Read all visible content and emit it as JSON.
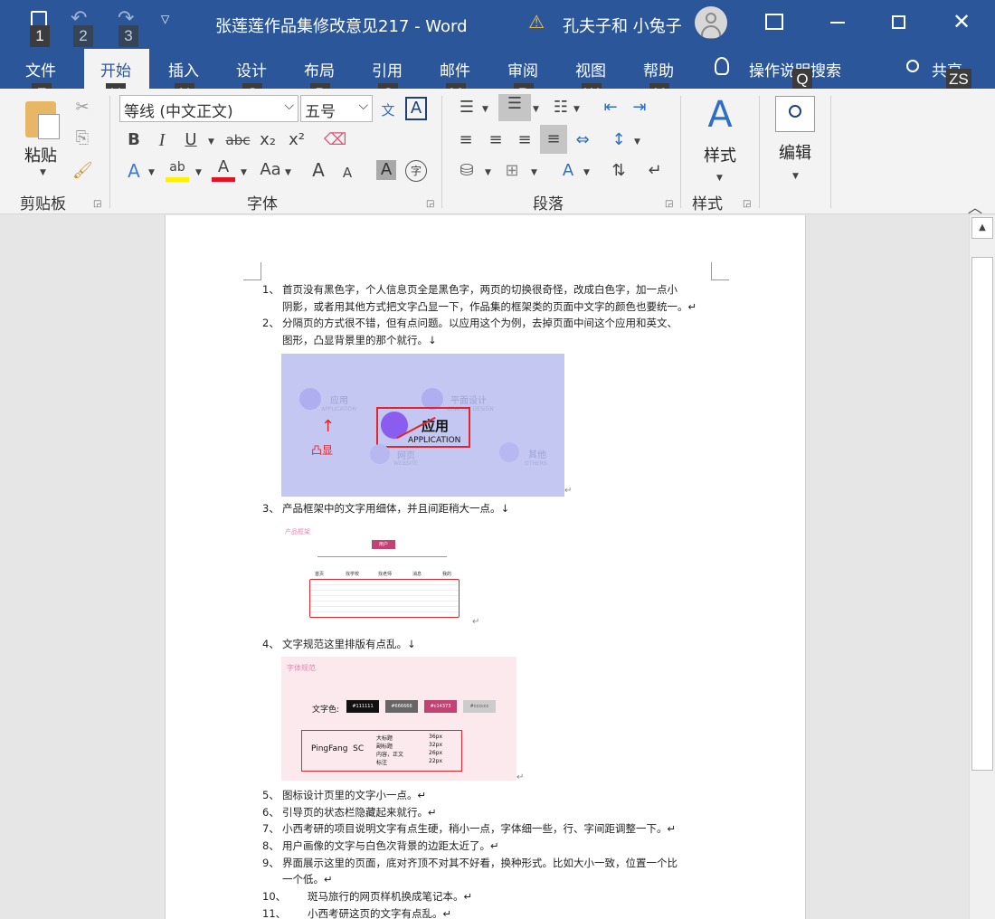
{
  "titlebar": {
    "title": "张莲莲作品集修改意见217 - Word",
    "user": "孔夫子和 小兔子",
    "keytips": [
      "1",
      "2",
      "3"
    ]
  },
  "tabs": [
    {
      "label": "文件",
      "key": "F"
    },
    {
      "label": "开始",
      "key": "H"
    },
    {
      "label": "插入",
      "key": "N"
    },
    {
      "label": "设计",
      "key": "G"
    },
    {
      "label": "布局",
      "key": "P"
    },
    {
      "label": "引用",
      "key": "S"
    },
    {
      "label": "邮件",
      "key": "M"
    },
    {
      "label": "审阅",
      "key": "R"
    },
    {
      "label": "视图",
      "key": "W"
    },
    {
      "label": "帮助",
      "key": "Y"
    }
  ],
  "tellme": {
    "label": "操作说明搜索",
    "key": "Q"
  },
  "share": {
    "label": "共享",
    "key": "ZS"
  },
  "ribbon": {
    "clipboard": {
      "paste": "粘贴",
      "label": "剪贴板"
    },
    "font": {
      "name": "等线 (中文正文)",
      "size": "五号",
      "label": "字体",
      "case": "Aa",
      "bold": "B",
      "italic": "I",
      "underline": "U",
      "strike": "abc",
      "sub": "x₂",
      "sup": "x²",
      "grow": "A",
      "shrink": "A",
      "highlight": "ab",
      "fontcolor": "A",
      "shade": "A",
      "phonetic": "文",
      "border": "A",
      "circle": "字"
    },
    "paragraph": {
      "label": "段落"
    },
    "styles": {
      "btn": "样式",
      "label": "样式"
    },
    "editing": {
      "btn": "编辑"
    }
  },
  "document": {
    "items": [
      {
        "num": "1、",
        "lines": [
          "首页没有黑色字，个人信息页全是黑色字，两页的切换很奇怪，改成白色字，加一点小",
          "阴影，或者用其他方式把文字凸显一下，作品集的框架类的页面中文字的颜色也要统一。↵"
        ]
      },
      {
        "num": "2、",
        "lines": [
          "分隔页的方式很不错，但有点问题。以应用这个为例，去掉页面中间这个应用和英文、",
          "图形，凸显背景里的那个就行。↓"
        ]
      },
      {
        "num": "3、",
        "lines": [
          "产品框架中的文字用细体，并且间距稍大一点。↓"
        ]
      },
      {
        "num": "4、",
        "lines": [
          "文字规范这里排版有点乱。↓"
        ]
      },
      {
        "num": "5、",
        "lines": [
          "图标设计页里的文字小一点。↵"
        ]
      },
      {
        "num": "6、",
        "lines": [
          "引导页的状态栏隐藏起来就行。↵"
        ]
      },
      {
        "num": "7、",
        "lines": [
          "小西考研的项目说明文字有点生硬，稍小一点，字体细一些，行、字间距调整一下。↵"
        ]
      },
      {
        "num": "8、",
        "lines": [
          "用户画像的文字与白色次背景的边距太近了。↵"
        ]
      },
      {
        "num": "9、",
        "lines": [
          "界面展示这里的页面，底对齐顶不对其不好看，换种形式。比如大小一致，位置一个比",
          "一个低。↵"
        ]
      },
      {
        "num": "10、",
        "lines": [
          "斑马旅行的网页样机换成笔记本。↵"
        ]
      },
      {
        "num": "11、",
        "lines": [
          "小西考研这页的文字有点乱。↵"
        ]
      }
    ],
    "img1": {
      "labels": [
        "应用",
        "APPLICATION",
        "平面设计",
        "GRAPHIC DESIGN",
        "应用",
        "APPLICATION",
        "凸显",
        "网页",
        "WEBSITE",
        "其他",
        "OTHERS"
      ]
    },
    "img2": {
      "title": "产品框架",
      "root": "用户",
      "cols": [
        "首页",
        "找学校",
        "找老师",
        "消息",
        "我的"
      ]
    },
    "img3": {
      "title": "字体规范",
      "color_label": "文字色:",
      "swatches": [
        "#111111",
        "#666666",
        "#c14373",
        "#cccccc"
      ],
      "font": "PingFang  SC",
      "sizes": [
        [
          "大标题",
          "36px"
        ],
        [
          "副标题",
          "32px"
        ],
        [
          "内容，正文",
          "26px"
        ],
        [
          "标注",
          "22px"
        ]
      ]
    }
  },
  "colors": {
    "brand": "#2b579a",
    "swatch_colors": [
      "#111111",
      "#666666",
      "#c14373",
      "#cccccc"
    ]
  }
}
